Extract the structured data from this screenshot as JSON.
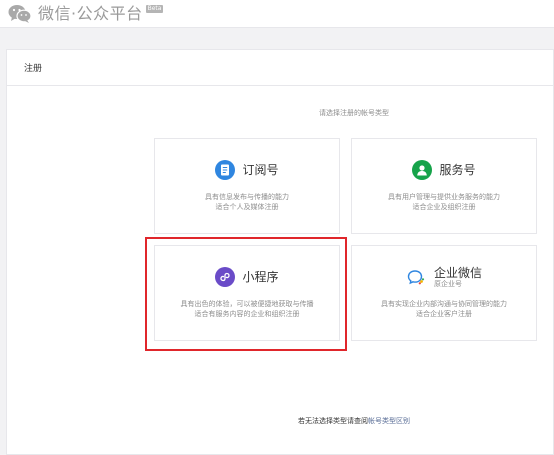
{
  "header": {
    "title": "微信·公众平台",
    "badge": "Beta",
    "logo_icon": "wechat-logo-icon"
  },
  "panel": {
    "heading": "注册",
    "prompt": "请选择注册的帐号类型"
  },
  "cards": [
    {
      "key": "subscription",
      "title": "订阅号",
      "icon": "document-icon",
      "icon_color": "#2f86e0",
      "desc_lines": [
        "具有信息发布与传播的能力",
        "适合个人及媒体注册"
      ]
    },
    {
      "key": "service",
      "title": "服务号",
      "icon": "person-icon",
      "icon_color": "#16a34a",
      "desc_lines": [
        "具有用户管理与提供业务服务的能力",
        "适合企业及组织注册"
      ]
    },
    {
      "key": "miniprogram",
      "title": "小程序",
      "icon": "miniprogram-icon",
      "icon_color": "#6a4bc8",
      "desc_lines": [
        "具有出色的体验，可以被便捷地获取与传播",
        "适合有服务内容的企业和组织注册"
      ]
    },
    {
      "key": "wework",
      "title": "企业微信",
      "subtitle": "原企业号",
      "icon": "chat-bubble-icon",
      "icon_color": "#2f86e0",
      "desc_lines": [
        "具有实现企业内部沟通与协同管理的能力",
        "适合企业客户注册"
      ]
    }
  ],
  "footer": {
    "text": "若无法选择类型请查阅",
    "link": "帐号类型区别"
  },
  "colors": {
    "highlight": "#e0262b",
    "link": "#576b95"
  }
}
